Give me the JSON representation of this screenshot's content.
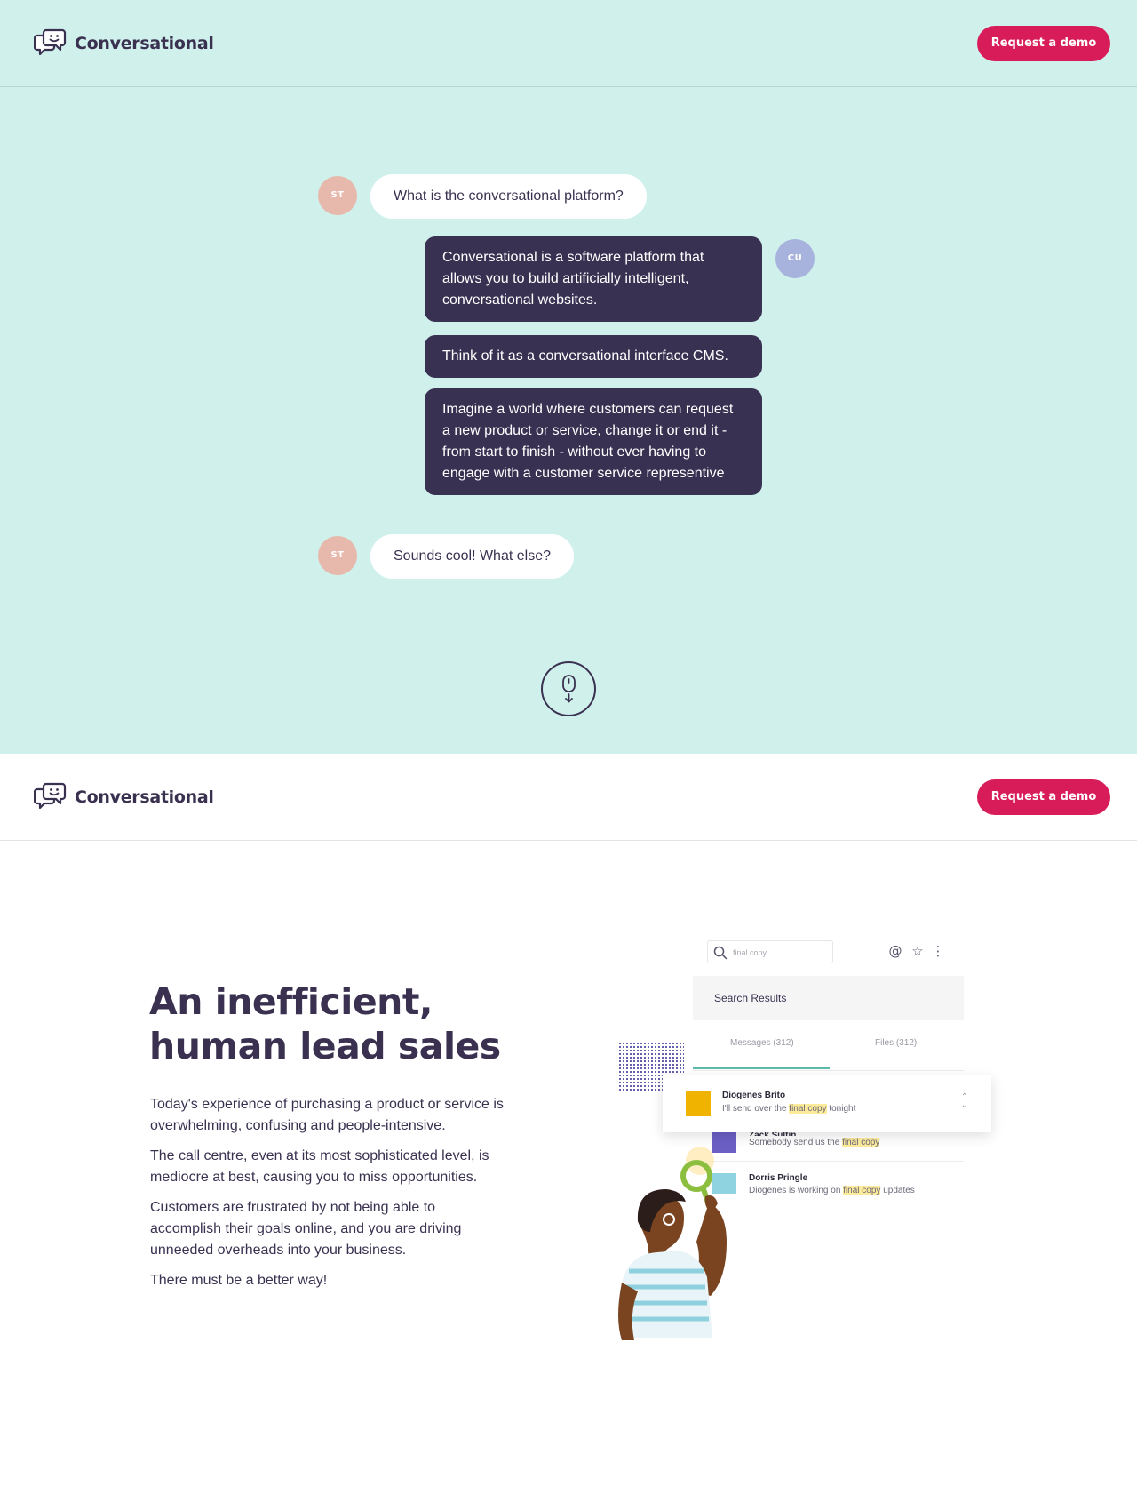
{
  "brand": {
    "name": "Conversational"
  },
  "nav": {
    "cta_label": "Request a demo"
  },
  "hero": {
    "messages": [
      {
        "from": "user",
        "avatar": "ST",
        "text": "What is the conversational platform?"
      },
      {
        "from": "bot",
        "avatar": "CU",
        "text": "Conversational is a software platform that allows you to build artificially intelligent, conversational websites."
      },
      {
        "from": "bot",
        "text": "Think of it as a conversational interface CMS."
      },
      {
        "from": "bot",
        "text": "Imagine a world where customers can request a new product or service, change it or end it - from start to finish - without ever having to engage with a customer service representive"
      },
      {
        "from": "user",
        "avatar": "ST",
        "text": "Sounds cool! What else?"
      }
    ],
    "scroll_icon": "mouse-scroll-icon"
  },
  "section": {
    "headline_line1": "An inefficient,",
    "headline_line2": "human lead sales",
    "paragraphs": [
      "Today's experience of purchasing a product or service is overwhelming, confusing and people-intensive.",
      "The call centre, even at its most sophisticated level, is mediocre at best, causing you to miss opportunities.",
      "Customers are frustrated by not being able to accomplish their goals online, and you are driving unneeded overheads into your business.",
      "There must be a better way!"
    ]
  },
  "illustration": {
    "search_placeholder": "final copy",
    "results_title": "Search Results",
    "tabs": [
      "Messages (312)",
      "Files (312)"
    ],
    "results": [
      {
        "name": "Diogenes Brito",
        "before": "I'll send over the ",
        "highlight": "final copy",
        "after": " tonight"
      },
      {
        "name": "Zack Sultin",
        "before": "Somebody send us the ",
        "highlight": "final copy",
        "after": ""
      },
      {
        "name": "Dorris Pringle",
        "before": "Diogenes is working on ",
        "highlight": "final copy",
        "after": " updates"
      }
    ],
    "icons": [
      "search-icon",
      "at-icon",
      "star-icon",
      "more-icon"
    ]
  },
  "colors": {
    "hero_bg": "#d0f0ec",
    "accent": "#d81c5a",
    "dark": "#393152",
    "avatar_st": "#e7b9ad",
    "avatar_cu": "#a7b3dc"
  }
}
